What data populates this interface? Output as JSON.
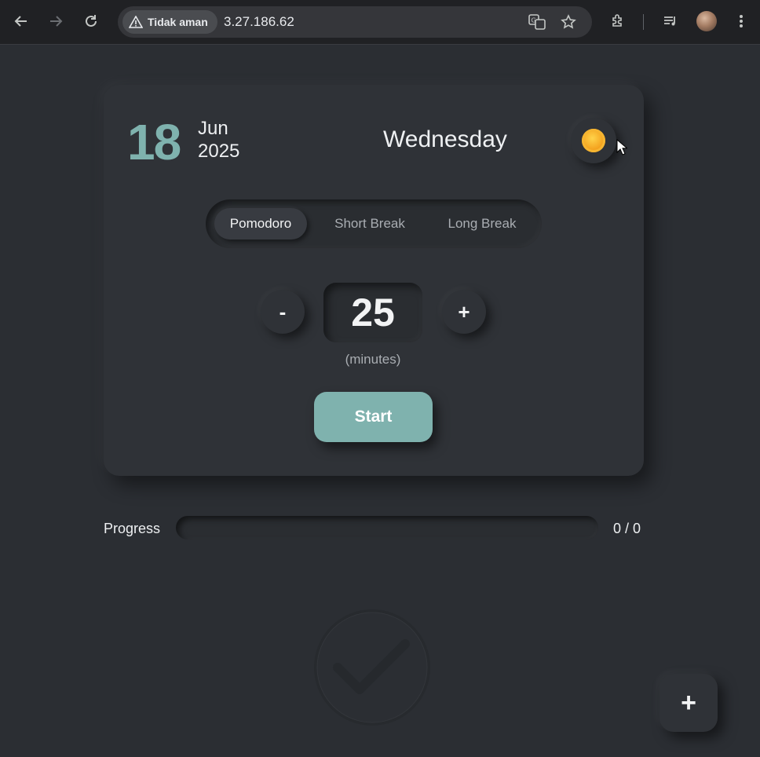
{
  "browser": {
    "security_label": "Tidak aman",
    "url": "3.27.186.62"
  },
  "date": {
    "day": "18",
    "month": "Jun",
    "year": "2025",
    "weekday": "Wednesday"
  },
  "theme_toggle": {
    "icon": "sun-icon"
  },
  "modes": [
    {
      "label": "Pomodoro",
      "active": true
    },
    {
      "label": "Short Break",
      "active": false
    },
    {
      "label": "Long Break",
      "active": false
    }
  ],
  "timer": {
    "decrement_label": "-",
    "minutes": "25",
    "increment_label": "+",
    "unit_label": "(minutes)"
  },
  "start_label": "Start",
  "progress": {
    "label": "Progress",
    "count": "0 / 0",
    "fraction": 0
  },
  "fab_label": "+",
  "colors": {
    "accent": "#7fb2ae",
    "background": "#2b2e33",
    "card": "#2f3237"
  }
}
